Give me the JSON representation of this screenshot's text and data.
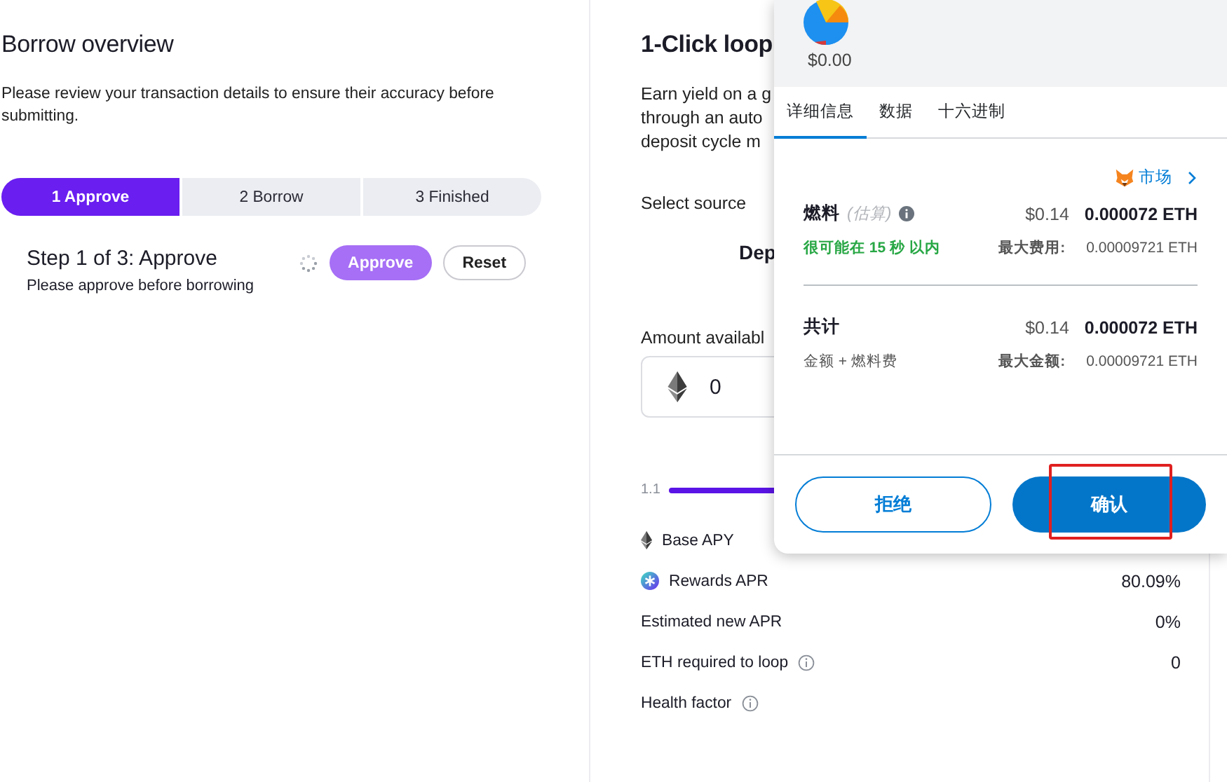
{
  "borrow": {
    "title": "Borrow overview",
    "description": "Please review your transaction details to ensure their accuracy before submitting.",
    "steps": [
      {
        "label": "1 Approve",
        "selected": true
      },
      {
        "label": "2 Borrow",
        "selected": false
      },
      {
        "label": "3 Finished",
        "selected": false
      }
    ],
    "step_title": "Step 1 of 3: Approve",
    "step_hint": "Please approve before borrowing",
    "loading": true,
    "buttons": [
      {
        "label": "Approve",
        "kind": "primary"
      },
      {
        "label": "Reset",
        "kind": "outline"
      }
    ]
  },
  "loop": {
    "title": "1-Click loop",
    "description_lines": [
      "Earn yield on a g",
      "through an auto",
      "deposit cycle m"
    ],
    "source_label": "Select source",
    "source_option": "Dep",
    "amount_label": "Amount availabl",
    "amount_value": "0",
    "slider_min": "1.1",
    "stats": [
      {
        "label": "Base APY",
        "kind": "eth"
      },
      {
        "label": "Rewards APR",
        "kind": "rewards",
        "value": "80.09%"
      },
      {
        "label": "Estimated new APR",
        "kind": "plain",
        "value": "0%"
      },
      {
        "label": "ETH required to loop",
        "kind": "info",
        "value": "0"
      },
      {
        "label": "Health factor",
        "kind": "info"
      }
    ]
  },
  "wallet": {
    "balance": "$0.00",
    "tabs": [
      {
        "label": "详细信息",
        "selected": true
      },
      {
        "label": "数据",
        "selected": false
      },
      {
        "label": "十六进制",
        "selected": false
      }
    ],
    "market_link": "市场",
    "gas": {
      "label": "燃料",
      "qualifier": "(估算)",
      "fiat": "$0.14",
      "amount": "0.000072 ETH",
      "eta": "很可能在 15 秒 以内",
      "max_label": "最大费用:",
      "max_value": "0.00009721 ETH"
    },
    "total": {
      "label": "共计",
      "sub": "金额 + 燃料费",
      "fiat": "$0.14",
      "amount": "0.000072 ETH",
      "max_label": "最大金额:",
      "max_value": "0.00009721 ETH"
    },
    "buttons": [
      {
        "label": "拒绝",
        "kind": "secondary",
        "highlighted": false
      },
      {
        "label": "确认",
        "kind": "primary",
        "highlighted": true
      }
    ]
  }
}
